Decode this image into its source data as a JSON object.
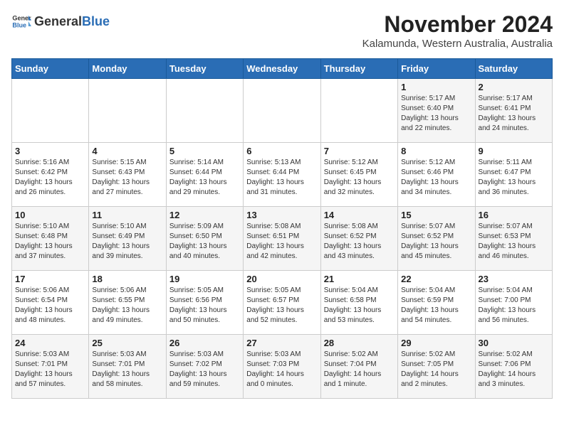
{
  "logo": {
    "general": "General",
    "blue": "Blue"
  },
  "title": "November 2024",
  "subtitle": "Kalamunda, Western Australia, Australia",
  "days_of_week": [
    "Sunday",
    "Monday",
    "Tuesday",
    "Wednesday",
    "Thursday",
    "Friday",
    "Saturday"
  ],
  "weeks": [
    [
      {
        "day": "",
        "info": ""
      },
      {
        "day": "",
        "info": ""
      },
      {
        "day": "",
        "info": ""
      },
      {
        "day": "",
        "info": ""
      },
      {
        "day": "",
        "info": ""
      },
      {
        "day": "1",
        "info": "Sunrise: 5:17 AM\nSunset: 6:40 PM\nDaylight: 13 hours\nand 22 minutes."
      },
      {
        "day": "2",
        "info": "Sunrise: 5:17 AM\nSunset: 6:41 PM\nDaylight: 13 hours\nand 24 minutes."
      }
    ],
    [
      {
        "day": "3",
        "info": "Sunrise: 5:16 AM\nSunset: 6:42 PM\nDaylight: 13 hours\nand 26 minutes."
      },
      {
        "day": "4",
        "info": "Sunrise: 5:15 AM\nSunset: 6:43 PM\nDaylight: 13 hours\nand 27 minutes."
      },
      {
        "day": "5",
        "info": "Sunrise: 5:14 AM\nSunset: 6:44 PM\nDaylight: 13 hours\nand 29 minutes."
      },
      {
        "day": "6",
        "info": "Sunrise: 5:13 AM\nSunset: 6:44 PM\nDaylight: 13 hours\nand 31 minutes."
      },
      {
        "day": "7",
        "info": "Sunrise: 5:12 AM\nSunset: 6:45 PM\nDaylight: 13 hours\nand 32 minutes."
      },
      {
        "day": "8",
        "info": "Sunrise: 5:12 AM\nSunset: 6:46 PM\nDaylight: 13 hours\nand 34 minutes."
      },
      {
        "day": "9",
        "info": "Sunrise: 5:11 AM\nSunset: 6:47 PM\nDaylight: 13 hours\nand 36 minutes."
      }
    ],
    [
      {
        "day": "10",
        "info": "Sunrise: 5:10 AM\nSunset: 6:48 PM\nDaylight: 13 hours\nand 37 minutes."
      },
      {
        "day": "11",
        "info": "Sunrise: 5:10 AM\nSunset: 6:49 PM\nDaylight: 13 hours\nand 39 minutes."
      },
      {
        "day": "12",
        "info": "Sunrise: 5:09 AM\nSunset: 6:50 PM\nDaylight: 13 hours\nand 40 minutes."
      },
      {
        "day": "13",
        "info": "Sunrise: 5:08 AM\nSunset: 6:51 PM\nDaylight: 13 hours\nand 42 minutes."
      },
      {
        "day": "14",
        "info": "Sunrise: 5:08 AM\nSunset: 6:52 PM\nDaylight: 13 hours\nand 43 minutes."
      },
      {
        "day": "15",
        "info": "Sunrise: 5:07 AM\nSunset: 6:52 PM\nDaylight: 13 hours\nand 45 minutes."
      },
      {
        "day": "16",
        "info": "Sunrise: 5:07 AM\nSunset: 6:53 PM\nDaylight: 13 hours\nand 46 minutes."
      }
    ],
    [
      {
        "day": "17",
        "info": "Sunrise: 5:06 AM\nSunset: 6:54 PM\nDaylight: 13 hours\nand 48 minutes."
      },
      {
        "day": "18",
        "info": "Sunrise: 5:06 AM\nSunset: 6:55 PM\nDaylight: 13 hours\nand 49 minutes."
      },
      {
        "day": "19",
        "info": "Sunrise: 5:05 AM\nSunset: 6:56 PM\nDaylight: 13 hours\nand 50 minutes."
      },
      {
        "day": "20",
        "info": "Sunrise: 5:05 AM\nSunset: 6:57 PM\nDaylight: 13 hours\nand 52 minutes."
      },
      {
        "day": "21",
        "info": "Sunrise: 5:04 AM\nSunset: 6:58 PM\nDaylight: 13 hours\nand 53 minutes."
      },
      {
        "day": "22",
        "info": "Sunrise: 5:04 AM\nSunset: 6:59 PM\nDaylight: 13 hours\nand 54 minutes."
      },
      {
        "day": "23",
        "info": "Sunrise: 5:04 AM\nSunset: 7:00 PM\nDaylight: 13 hours\nand 56 minutes."
      }
    ],
    [
      {
        "day": "24",
        "info": "Sunrise: 5:03 AM\nSunset: 7:01 PM\nDaylight: 13 hours\nand 57 minutes."
      },
      {
        "day": "25",
        "info": "Sunrise: 5:03 AM\nSunset: 7:01 PM\nDaylight: 13 hours\nand 58 minutes."
      },
      {
        "day": "26",
        "info": "Sunrise: 5:03 AM\nSunset: 7:02 PM\nDaylight: 13 hours\nand 59 minutes."
      },
      {
        "day": "27",
        "info": "Sunrise: 5:03 AM\nSunset: 7:03 PM\nDaylight: 14 hours\nand 0 minutes."
      },
      {
        "day": "28",
        "info": "Sunrise: 5:02 AM\nSunset: 7:04 PM\nDaylight: 14 hours\nand 1 minute."
      },
      {
        "day": "29",
        "info": "Sunrise: 5:02 AM\nSunset: 7:05 PM\nDaylight: 14 hours\nand 2 minutes."
      },
      {
        "day": "30",
        "info": "Sunrise: 5:02 AM\nSunset: 7:06 PM\nDaylight: 14 hours\nand 3 minutes."
      }
    ]
  ]
}
